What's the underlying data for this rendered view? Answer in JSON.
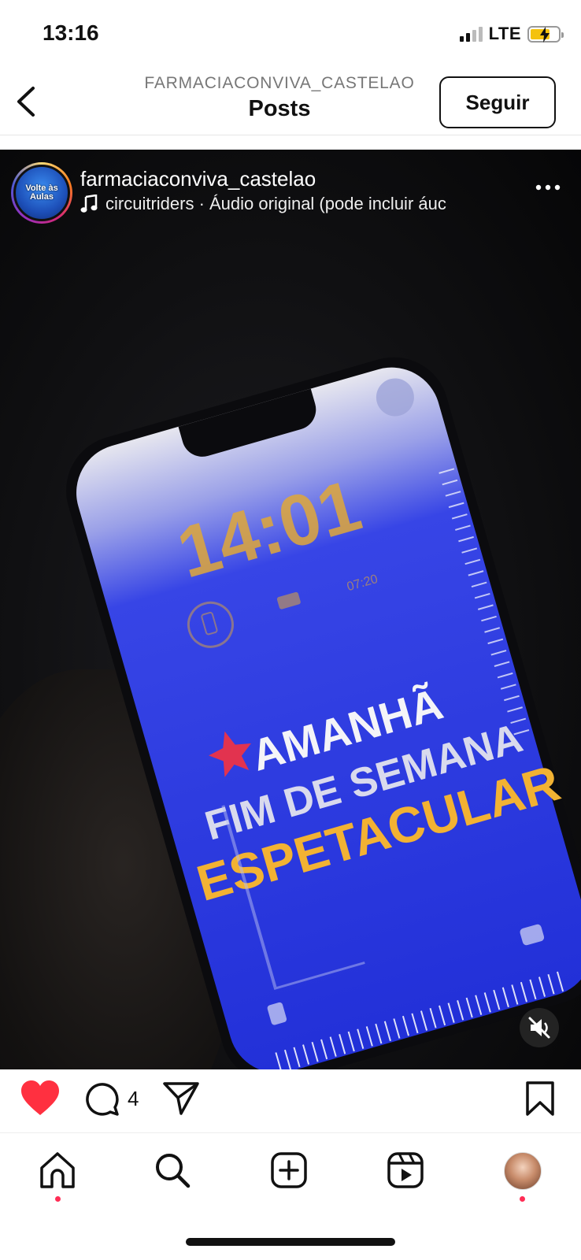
{
  "status": {
    "time": "13:16",
    "network": "LTE"
  },
  "header": {
    "subtitle": "FARMACIACONVIVA_CASTELAO",
    "title": "Posts",
    "follow_label": "Seguir"
  },
  "post": {
    "username": "farmaciaconviva_castelao",
    "audio": "circuitriders · Áudio original  (pode incluir áuc",
    "avatar_text": "Volte às Aulas",
    "video": {
      "lockscreen_time": "14:01",
      "widget_time": "07:20",
      "line1": "AMANHÃ",
      "line2": "FIM DE SEMANA",
      "line3": "ESPETACULAR"
    },
    "liked": true,
    "comment_count": "4"
  },
  "colors": {
    "like": "#ff3040",
    "screen_blue": "#2f3de8",
    "gold": "#f2b233",
    "badge_dot": "#ff2d55"
  }
}
